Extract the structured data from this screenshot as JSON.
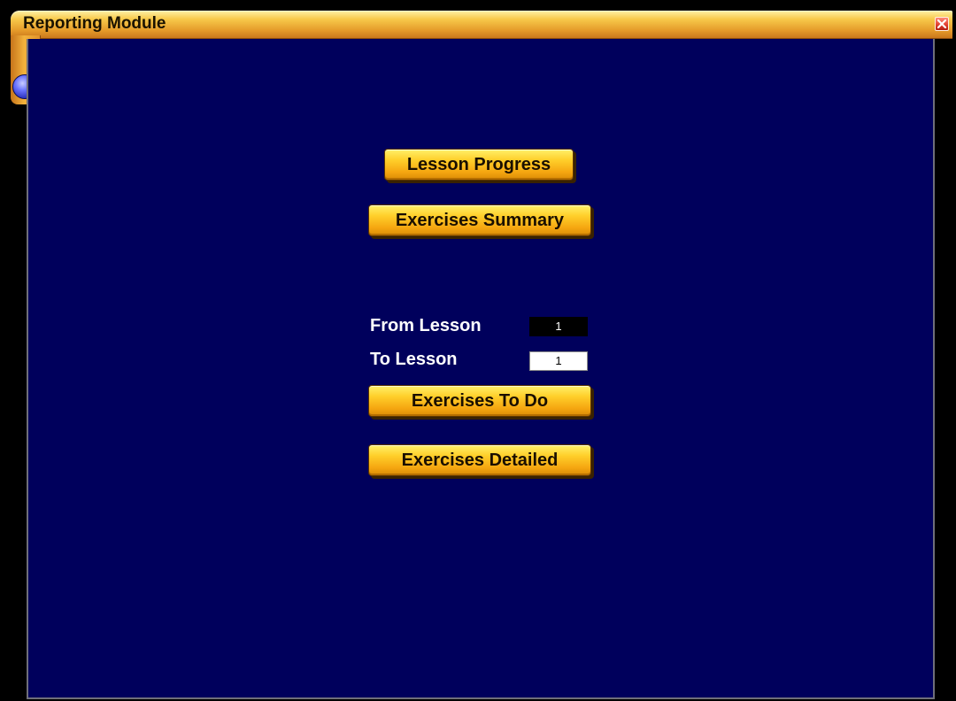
{
  "window": {
    "title": "Reporting Module",
    "close_icon": "close-icon",
    "orb_icon": "orb-icon"
  },
  "buttons": {
    "lesson_progress": "Lesson Progress",
    "exercises_summary": "Exercises Summary",
    "exercises_to_do": "Exercises To Do",
    "exercises_detailed": "Exercises Detailed"
  },
  "range": {
    "from_label": "From Lesson",
    "from_value": "1",
    "to_label": "To Lesson",
    "to_value": "1"
  },
  "colors": {
    "panel_background": "#00005c",
    "button_gold": "#ffcf2a",
    "titlebar_orange": "#e59b2a"
  }
}
